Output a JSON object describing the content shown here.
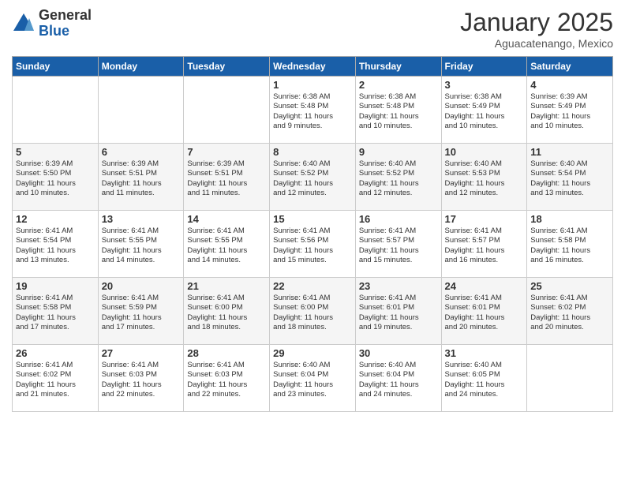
{
  "logo": {
    "general": "General",
    "blue": "Blue"
  },
  "title": "January 2025",
  "subtitle": "Aguacatenango, Mexico",
  "weekdays": [
    "Sunday",
    "Monday",
    "Tuesday",
    "Wednesday",
    "Thursday",
    "Friday",
    "Saturday"
  ],
  "weeks": [
    [
      {
        "day": "",
        "info": ""
      },
      {
        "day": "",
        "info": ""
      },
      {
        "day": "",
        "info": ""
      },
      {
        "day": "1",
        "info": "Sunrise: 6:38 AM\nSunset: 5:48 PM\nDaylight: 11 hours\nand 9 minutes."
      },
      {
        "day": "2",
        "info": "Sunrise: 6:38 AM\nSunset: 5:48 PM\nDaylight: 11 hours\nand 10 minutes."
      },
      {
        "day": "3",
        "info": "Sunrise: 6:38 AM\nSunset: 5:49 PM\nDaylight: 11 hours\nand 10 minutes."
      },
      {
        "day": "4",
        "info": "Sunrise: 6:39 AM\nSunset: 5:49 PM\nDaylight: 11 hours\nand 10 minutes."
      }
    ],
    [
      {
        "day": "5",
        "info": "Sunrise: 6:39 AM\nSunset: 5:50 PM\nDaylight: 11 hours\nand 10 minutes."
      },
      {
        "day": "6",
        "info": "Sunrise: 6:39 AM\nSunset: 5:51 PM\nDaylight: 11 hours\nand 11 minutes."
      },
      {
        "day": "7",
        "info": "Sunrise: 6:39 AM\nSunset: 5:51 PM\nDaylight: 11 hours\nand 11 minutes."
      },
      {
        "day": "8",
        "info": "Sunrise: 6:40 AM\nSunset: 5:52 PM\nDaylight: 11 hours\nand 12 minutes."
      },
      {
        "day": "9",
        "info": "Sunrise: 6:40 AM\nSunset: 5:52 PM\nDaylight: 11 hours\nand 12 minutes."
      },
      {
        "day": "10",
        "info": "Sunrise: 6:40 AM\nSunset: 5:53 PM\nDaylight: 11 hours\nand 12 minutes."
      },
      {
        "day": "11",
        "info": "Sunrise: 6:40 AM\nSunset: 5:54 PM\nDaylight: 11 hours\nand 13 minutes."
      }
    ],
    [
      {
        "day": "12",
        "info": "Sunrise: 6:41 AM\nSunset: 5:54 PM\nDaylight: 11 hours\nand 13 minutes."
      },
      {
        "day": "13",
        "info": "Sunrise: 6:41 AM\nSunset: 5:55 PM\nDaylight: 11 hours\nand 14 minutes."
      },
      {
        "day": "14",
        "info": "Sunrise: 6:41 AM\nSunset: 5:55 PM\nDaylight: 11 hours\nand 14 minutes."
      },
      {
        "day": "15",
        "info": "Sunrise: 6:41 AM\nSunset: 5:56 PM\nDaylight: 11 hours\nand 15 minutes."
      },
      {
        "day": "16",
        "info": "Sunrise: 6:41 AM\nSunset: 5:57 PM\nDaylight: 11 hours\nand 15 minutes."
      },
      {
        "day": "17",
        "info": "Sunrise: 6:41 AM\nSunset: 5:57 PM\nDaylight: 11 hours\nand 16 minutes."
      },
      {
        "day": "18",
        "info": "Sunrise: 6:41 AM\nSunset: 5:58 PM\nDaylight: 11 hours\nand 16 minutes."
      }
    ],
    [
      {
        "day": "19",
        "info": "Sunrise: 6:41 AM\nSunset: 5:58 PM\nDaylight: 11 hours\nand 17 minutes."
      },
      {
        "day": "20",
        "info": "Sunrise: 6:41 AM\nSunset: 5:59 PM\nDaylight: 11 hours\nand 17 minutes."
      },
      {
        "day": "21",
        "info": "Sunrise: 6:41 AM\nSunset: 6:00 PM\nDaylight: 11 hours\nand 18 minutes."
      },
      {
        "day": "22",
        "info": "Sunrise: 6:41 AM\nSunset: 6:00 PM\nDaylight: 11 hours\nand 18 minutes."
      },
      {
        "day": "23",
        "info": "Sunrise: 6:41 AM\nSunset: 6:01 PM\nDaylight: 11 hours\nand 19 minutes."
      },
      {
        "day": "24",
        "info": "Sunrise: 6:41 AM\nSunset: 6:01 PM\nDaylight: 11 hours\nand 20 minutes."
      },
      {
        "day": "25",
        "info": "Sunrise: 6:41 AM\nSunset: 6:02 PM\nDaylight: 11 hours\nand 20 minutes."
      }
    ],
    [
      {
        "day": "26",
        "info": "Sunrise: 6:41 AM\nSunset: 6:02 PM\nDaylight: 11 hours\nand 21 minutes."
      },
      {
        "day": "27",
        "info": "Sunrise: 6:41 AM\nSunset: 6:03 PM\nDaylight: 11 hours\nand 22 minutes."
      },
      {
        "day": "28",
        "info": "Sunrise: 6:41 AM\nSunset: 6:03 PM\nDaylight: 11 hours\nand 22 minutes."
      },
      {
        "day": "29",
        "info": "Sunrise: 6:40 AM\nSunset: 6:04 PM\nDaylight: 11 hours\nand 23 minutes."
      },
      {
        "day": "30",
        "info": "Sunrise: 6:40 AM\nSunset: 6:04 PM\nDaylight: 11 hours\nand 24 minutes."
      },
      {
        "day": "31",
        "info": "Sunrise: 6:40 AM\nSunset: 6:05 PM\nDaylight: 11 hours\nand 24 minutes."
      },
      {
        "day": "",
        "info": ""
      }
    ]
  ]
}
